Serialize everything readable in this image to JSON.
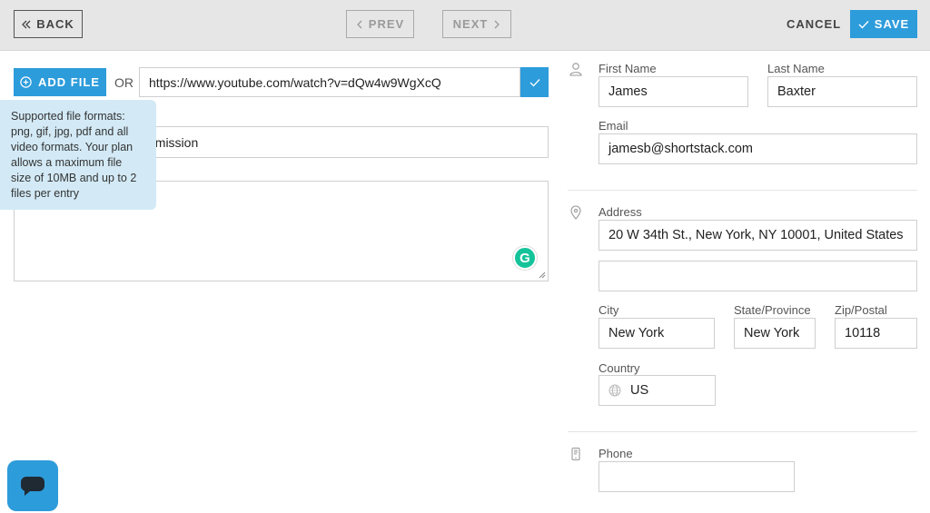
{
  "toolbar": {
    "back_label": "BACK",
    "prev_label": "PREV",
    "next_label": "NEXT",
    "cancel_label": "CANCEL",
    "save_label": "SAVE"
  },
  "media": {
    "add_file_label": "ADD FILE",
    "or_label": "OR",
    "url_value": "https://www.youtube.com/watch?v=dQw4w9WgXcQ",
    "title_value_visible": "omission",
    "tooltip": [
      "Supported file formats:",
      "png, gif, jpg, pdf and all",
      "video formats. Your plan",
      "allows a maximum file",
      "size of 10MB and up to 2",
      "files per entry"
    ],
    "grammarly_letter": "G"
  },
  "contact": {
    "first_name_label": "First Name",
    "first_name": "James",
    "last_name_label": "Last Name",
    "last_name": "Baxter",
    "email_label": "Email",
    "email": "jamesb@shortstack.com"
  },
  "address": {
    "address_label": "Address",
    "line1": "20 W 34th St., New York, NY 10001, United States",
    "line2": "",
    "city_label": "City",
    "city": "New York",
    "state_label": "State/Province",
    "state": "New York",
    "zip_label": "Zip/Postal",
    "zip": "10118",
    "country_label": "Country",
    "country": "US"
  },
  "phone": {
    "phone_label": "Phone",
    "phone": ""
  },
  "colors": {
    "accent": "#2d9cdb",
    "toolbar_bg": "#e6e6e6",
    "tooltip_bg": "#d3eaf6"
  }
}
